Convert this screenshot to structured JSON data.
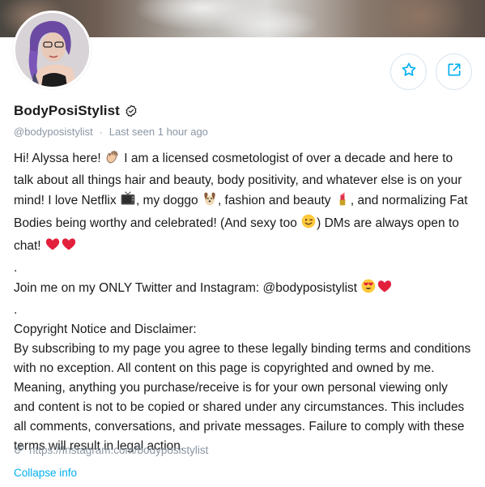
{
  "profile": {
    "name": "BodyPosiStylist",
    "handle": "@bodyposistylist",
    "separator": "·",
    "last_seen": "Last seen 1 hour ago"
  },
  "actions": {
    "favorite_icon": "star-icon",
    "share_icon": "share-icon"
  },
  "bio": {
    "p1_a": "Hi! Alyssa here! ",
    "p1_b": " I am a licensed cosmetologist of over a decade and here to talk about all things hair and beauty, body positivity, and whatever else is on your mind! I love Netflix ",
    "p1_c": ", my doggo ",
    "p1_d": ", fashion and beauty ",
    "p1_e": ", and normalizing Fat Bodies being worthy and celebrated! (And sexy too ",
    "p1_f": ") DMs are always open to chat! ",
    "sep1": ".",
    "p2": "Join me on my ONLY Twitter and Instagram: @bodyposistylist ",
    "sep2": ".",
    "p3_title": "Copyright Notice and Disclaimer:",
    "p3_body": "By subscribing to my page you agree to these legally binding terms and conditions with no exception. All content on this page is copyrighted and owned by me. Meaning, anything you purchase/receive is for your own personal viewing only and content is not to be copied or shared under any circumstances. This includes all comments, conversations, and private messages. Failure to comply with these terms will result in legal action."
  },
  "link": {
    "url": "https://Instagram.com/bodyposistylist"
  },
  "collapse_label": "Collapse info",
  "colors": {
    "accent": "#00aff0",
    "muted": "#8a96a3",
    "text": "#1a1a1a"
  }
}
